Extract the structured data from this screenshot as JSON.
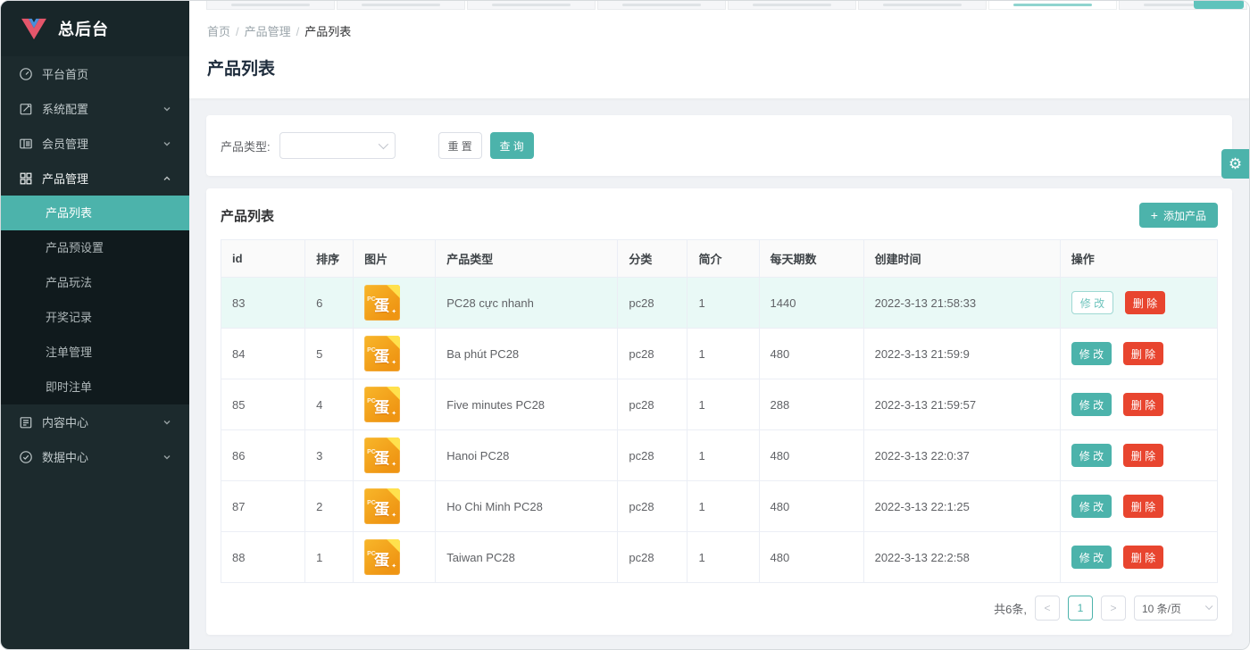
{
  "app": {
    "logo_text": "总后台"
  },
  "sidebar": {
    "items": [
      {
        "label": "平台首页",
        "icon": "dashboard-icon"
      },
      {
        "label": "系统配置",
        "icon": "edit-icon",
        "chevron": "down"
      },
      {
        "label": "会员管理",
        "icon": "members-icon",
        "chevron": "down"
      },
      {
        "label": "产品管理",
        "icon": "grid-icon",
        "chevron": "up",
        "expanded": true,
        "children": [
          "产品列表",
          "产品预设置",
          "产品玩法",
          "开奖记录",
          "注单管理",
          "即时注单"
        ],
        "active_child": "产品列表"
      },
      {
        "label": "内容中心",
        "icon": "content-icon",
        "chevron": "down"
      },
      {
        "label": "数据中心",
        "icon": "data-icon",
        "chevron": "down"
      }
    ]
  },
  "breadcrumb": [
    "首页",
    "产品管理",
    "产品列表"
  ],
  "page_title": "产品列表",
  "filter": {
    "label": "产品类型:",
    "select_value": "",
    "reset_label": "重 置",
    "query_label": "查 询"
  },
  "table_card": {
    "title": "产品列表",
    "add_label": "添加产品",
    "plus_icon": "+"
  },
  "table": {
    "columns": [
      "id",
      "排序",
      "图片",
      "产品类型",
      "分类",
      "简介",
      "每天期数",
      "创建时间",
      "操作"
    ],
    "image_char": "蛋",
    "image_side_text": "PC",
    "image_spark": "✦",
    "edit_label": "修 改",
    "delete_label": "删 除",
    "rows": [
      {
        "id": "83",
        "sort": "6",
        "type": "PC28 cực nhanh",
        "category": "pc28",
        "intro": "1",
        "periods": "1440",
        "created": "2022-3-13 21:58:33",
        "highlighted": true
      },
      {
        "id": "84",
        "sort": "5",
        "type": "Ba phút PC28",
        "category": "pc28",
        "intro": "1",
        "periods": "480",
        "created": "2022-3-13 21:59:9",
        "highlighted": false
      },
      {
        "id": "85",
        "sort": "4",
        "type": "Five minutes PC28",
        "category": "pc28",
        "intro": "1",
        "periods": "288",
        "created": "2022-3-13 21:59:57",
        "highlighted": false
      },
      {
        "id": "86",
        "sort": "3",
        "type": "Hanoi PC28",
        "category": "pc28",
        "intro": "1",
        "periods": "480",
        "created": "2022-3-13 22:0:37",
        "highlighted": false
      },
      {
        "id": "87",
        "sort": "2",
        "type": "Ho Chi Minh PC28",
        "category": "pc28",
        "intro": "1",
        "periods": "480",
        "created": "2022-3-13 22:1:25",
        "highlighted": false
      },
      {
        "id": "88",
        "sort": "1",
        "type": "Taiwan PC28",
        "category": "pc28",
        "intro": "1",
        "periods": "480",
        "created": "2022-3-13 22:2:58",
        "highlighted": false
      }
    ]
  },
  "pagination": {
    "total_text": "共6条,",
    "prev": "<",
    "page": "1",
    "next": ">",
    "page_size": "10 条/页"
  },
  "colors": {
    "accent_teal": "#4cb3ab",
    "danger_red": "#e8452f",
    "sidebar_bg": "#1c2a2d",
    "submenu_bg": "#101a1d",
    "highlight_row": "#e9f9f6",
    "content_bg": "#f0f2f5",
    "thumb_orange": "#f0a218"
  }
}
